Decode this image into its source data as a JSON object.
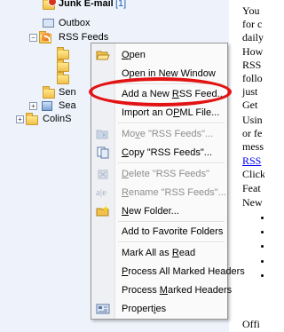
{
  "tree": {
    "junk_mail_label": "Junk E-mail",
    "junk_mail_count": "[1]",
    "outbox_label": "Outbox",
    "rss_feeds_label": "RSS Feeds",
    "sent_partial": "Sen",
    "search_partial": "Sea",
    "colin_partial": "ColinS"
  },
  "menu": {
    "items": [
      {
        "label": "Open",
        "icon": "open-folder-icon",
        "enabled": true
      },
      {
        "label": "Open in New Window",
        "icon": "",
        "enabled": true
      },
      {
        "label": "Add a New RSS Feed...",
        "icon": "",
        "enabled": true
      },
      {
        "label": "Import an OPML File...",
        "icon": "",
        "enabled": true
      },
      {
        "label": "Move \"RSS Feeds\"...",
        "icon": "move-folder-icon",
        "enabled": false
      },
      {
        "label": "Copy \"RSS Feeds\"...",
        "icon": "copy-folder-icon",
        "enabled": true
      },
      {
        "label": "Delete \"RSS Feeds\"",
        "icon": "delete-icon",
        "enabled": false
      },
      {
        "label": "Rename \"RSS Feeds\"...",
        "icon": "rename-icon",
        "enabled": false
      },
      {
        "label": "New Folder...",
        "icon": "new-folder-icon",
        "enabled": true
      },
      {
        "label": "Add to Favorite Folders",
        "icon": "",
        "enabled": true
      },
      {
        "label": "Mark All as Read",
        "icon": "",
        "enabled": true
      },
      {
        "label": "Process All Marked Headers",
        "icon": "",
        "enabled": true
      },
      {
        "label": "Process Marked Headers",
        "icon": "",
        "enabled": true
      },
      {
        "label": "Properties",
        "icon": "properties-icon",
        "enabled": true
      }
    ],
    "highlight_color": "#e21313"
  },
  "doc": {
    "lines": [
      "You",
      "for c",
      "daily",
      "How",
      "RSS",
      "follo",
      "just",
      "Get",
      "Usin",
      "or fe",
      "mess",
      "RSS",
      "Click",
      "Feat",
      "New"
    ],
    "footer": "Offi"
  }
}
